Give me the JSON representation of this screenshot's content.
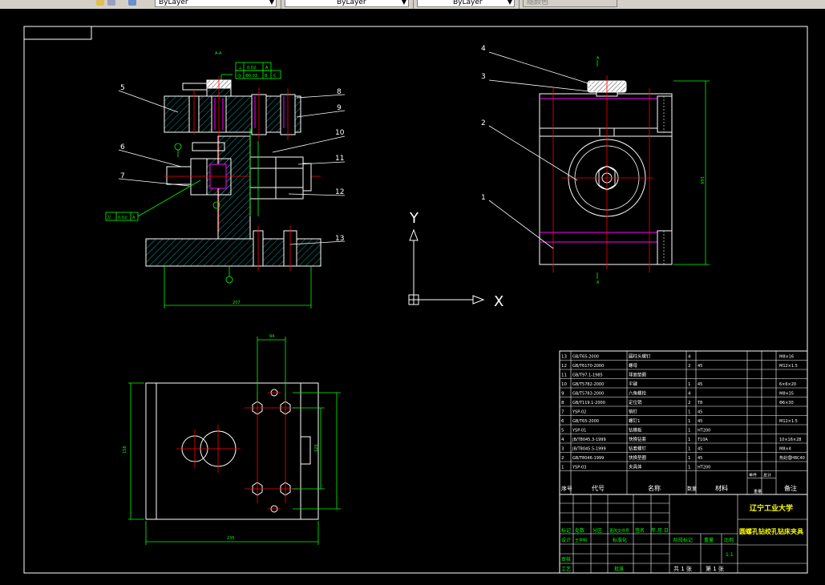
{
  "toolbar": {
    "layer_value": "ByLayer",
    "linetype_value": "ByLayer",
    "lineweight_value": "ByLayer",
    "plotstyle_value": "随颜色"
  },
  "drawing": {
    "section_label": "A-A",
    "view_label": "A",
    "tolerance_box": {
      "row1": [
        "⊥",
        "0.02",
        "A"
      ],
      "row2": [
        "◎",
        "Φ0.03",
        "B",
        "C"
      ]
    },
    "parallel_tol": [
      "//",
      "0.02",
      "A"
    ],
    "balloons": [
      "1",
      "2",
      "3",
      "4",
      "5",
      "6",
      "7",
      "8",
      "9",
      "10",
      "11",
      "12",
      "13"
    ],
    "dims": {
      "base_width": "207",
      "side_height": "164",
      "plan_width": "235",
      "plan_height": "158",
      "hole_spacing": "94",
      "hole_vertical": "120"
    },
    "ucs": {
      "x": "X",
      "y": "Y"
    }
  },
  "bom": {
    "rows": [
      {
        "no": "13",
        "std": "GB/T65-2000",
        "name": "圆柱头螺钉",
        "qty": "4",
        "mat": "",
        "wt": "",
        "note": "M8×16"
      },
      {
        "no": "12",
        "std": "GB/T6170-2000",
        "name": "螺母",
        "qty": "2",
        "mat": "45",
        "wt": "",
        "note": "M12×1.5"
      },
      {
        "no": "11",
        "std": "GB/T97.1-1985",
        "name": "球面垫圈",
        "qty": "",
        "mat": "",
        "wt": "",
        "note": ""
      },
      {
        "no": "10",
        "std": "GB/T5782-2000",
        "name": "平键",
        "qty": "1",
        "mat": "45",
        "wt": "",
        "note": "6×6×20"
      },
      {
        "no": "9",
        "std": "GB/T5783-2000",
        "name": "六角螺栓",
        "qty": "4",
        "mat": "",
        "wt": "",
        "note": "M8×35"
      },
      {
        "no": "8",
        "std": "GB/T119.1-2000",
        "name": "定位销",
        "qty": "2",
        "mat": "T8",
        "wt": "",
        "note": "Φ6×30"
      },
      {
        "no": "7",
        "std": "YSP-02",
        "name": "销钉",
        "qty": "1",
        "mat": "45",
        "wt": "",
        "note": ""
      },
      {
        "no": "6",
        "std": "GB/T65-2000",
        "name": "螺钉1",
        "qty": "1",
        "mat": "45",
        "wt": "",
        "note": "M12×1.5"
      },
      {
        "no": "5",
        "std": "YSP-01",
        "name": "钻模板",
        "qty": "1",
        "mat": "HT200",
        "wt": "",
        "note": ""
      },
      {
        "no": "4",
        "std": "JB/T8045.3-1999",
        "name": "快换钻套",
        "qty": "1",
        "mat": "T10A",
        "wt": "",
        "note": "10×16×28"
      },
      {
        "no": "3",
        "std": "JB/T8045.5-1999",
        "name": "钻套螺钉",
        "qty": "1",
        "mat": "45",
        "wt": "",
        "note": "M8×4"
      },
      {
        "no": "2",
        "std": "GB/T8046-1999",
        "name": "快换垫圈",
        "qty": "1",
        "mat": "45",
        "wt": "",
        "note": "热处理HRC40"
      },
      {
        "no": "1",
        "std": "YSP-03",
        "name": "夹具体",
        "qty": "1",
        "mat": "HT200",
        "wt": "",
        "note": ""
      }
    ],
    "header": {
      "no": "序号",
      "std": "代号",
      "name": "名称",
      "qty": "数量",
      "mat": "材料",
      "single": "单件",
      "total": "总计",
      "weight": "重量",
      "note": "备注"
    }
  },
  "title_block": {
    "university": "辽宁工业大学",
    "drawing_name": "圆螺孔钻绞孔钻床夹具",
    "row_labels": [
      "标记",
      "处数",
      "分区",
      "更改文件号",
      "签名",
      "年.月.日"
    ],
    "design_label": "设计",
    "std_label": "标准化",
    "review_label": "审核",
    "process_label": "工艺",
    "approve_label": "批准",
    "stage_label": "阶段标记",
    "weight_label": "重量",
    "scale_label": "比例",
    "scale_value": "1:1",
    "sheets": "共 1 张",
    "sheet": "第 1 张",
    "designer": "王学明"
  },
  "colors": {
    "bg": "#000000",
    "line": "#ffffff",
    "green": "#00ff00",
    "red": "#ff0000",
    "magenta": "#ff00ff",
    "cyan": "#00ffff",
    "yellow": "#ffff00"
  }
}
